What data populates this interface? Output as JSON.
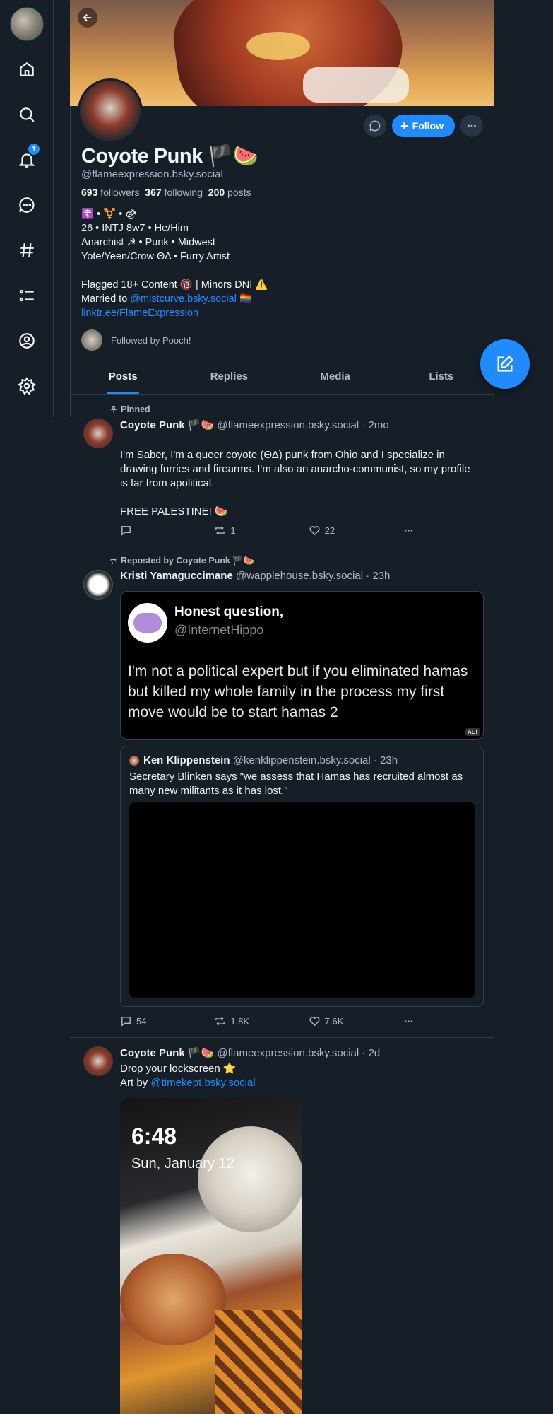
{
  "nav": {
    "notification_count": "1",
    "items": [
      "home",
      "search",
      "notifications",
      "chat",
      "feeds",
      "lists",
      "profile",
      "settings"
    ]
  },
  "profile": {
    "display_name": "Coyote Punk 🏴🍉",
    "handle": "@flameexpression.bsky.social",
    "followers_count": "693",
    "followers_label": "followers",
    "following_count": "367",
    "following_label": "following",
    "posts_count": "200",
    "posts_label": "posts",
    "bio_line1": "☦️ • ⚧️ • ⚣",
    "bio_line2": "26 • INTJ 8w7 • He/Him",
    "bio_line3": "Anarchist ☭ • Punk • Midwest",
    "bio_line4": "Yote/Yeen/Crow ΘΔ • Furry Artist",
    "bio_line5": "Flagged 18+ Content 🔞 | Minors DNI ⚠️",
    "bio_married_prefix": "Married to ",
    "bio_married_link": "@mistcurve.bsky.social",
    "bio_married_suffix": " 🏳️‍🌈",
    "bio_link": "linktr.ee/FlameExpression",
    "followed_by": "Followed by Pooch!",
    "follow_label": "Follow"
  },
  "tabs": [
    "Posts",
    "Replies",
    "Media",
    "Lists"
  ],
  "posts": [
    {
      "context": "Pinned",
      "author": "Coyote Punk 🏴🍉",
      "meta": "@flameexpression.bsky.social · 2mo",
      "text": "I'm Saber, I'm a queer coyote (ΘΔ) punk from Ohio and I specialize in drawing furries and firearms. I'm also an anarcho-communist, so my profile is far from apolitical.\n\nFREE PALESTINE! 🍉",
      "replies": "",
      "reposts": "1",
      "likes": "22"
    },
    {
      "context": "Reposted by Coyote Punk 🏴🍉",
      "author": "Kristi Yamaguccimane",
      "meta": "@wapplehouse.bsky.social · 23h",
      "image_title": "Honest question,",
      "image_handle": "@InternetHippo",
      "image_text": "I'm not a political expert but if you eliminated hamas but killed my whole family in the process my first move would be to start hamas 2",
      "alt_badge": "ALT",
      "quote_author": "Ken Klippenstein",
      "quote_meta": "@kenklippenstein.bsky.social · 23h",
      "quote_text": "Secretary Blinken says \"we assess that Hamas has recruited almost as many new militants as it has lost.\"",
      "replies": "54",
      "reposts": "1.8K",
      "likes": "7.6K"
    },
    {
      "context": "",
      "author": "Coyote Punk 🏴🍉",
      "meta": "@flameexpression.bsky.social · 2d",
      "text_line1": "Drop your lockscreen ⭐",
      "text_line2_prefix": "Art by ",
      "text_line2_link": "@timekept.bsky.social",
      "lock_time": "6:48",
      "lock_date": "Sun, January 12"
    }
  ],
  "colors": {
    "background": "#161e27",
    "accent": "#208bfe",
    "muted_text": "#aebbc9",
    "border": "#2e4052"
  }
}
